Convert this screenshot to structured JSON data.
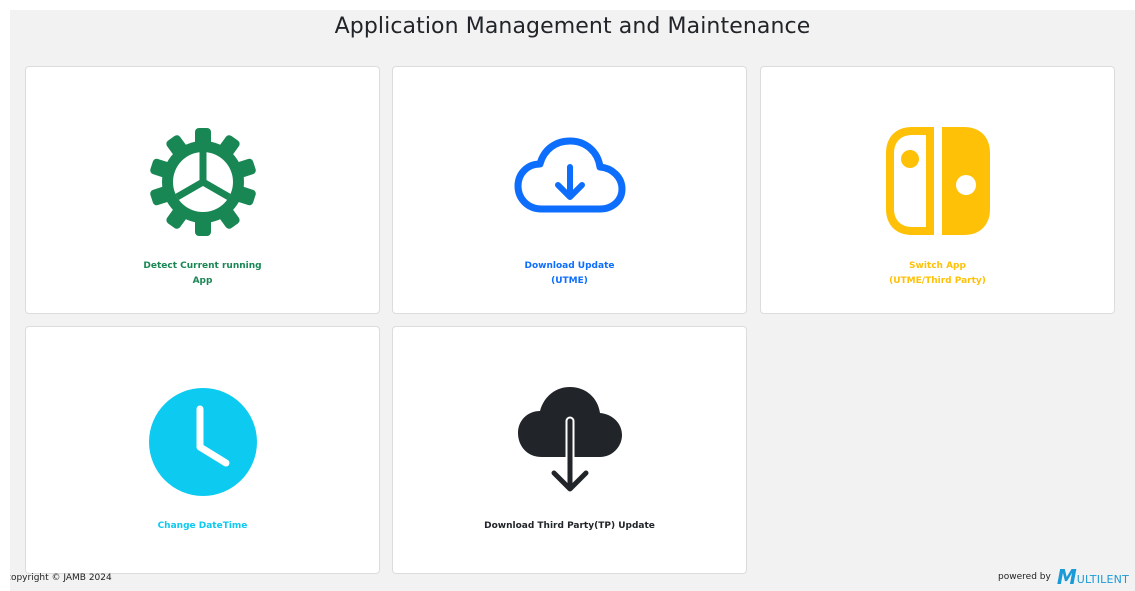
{
  "header": {
    "title": "Application Management and Maintenance"
  },
  "cards": [
    {
      "icon": "gear-icon",
      "color": "#198754",
      "label_lines": [
        "Detect Current running",
        "App"
      ]
    },
    {
      "icon": "cloud-download-icon",
      "color": "#0d6efd",
      "label_lines": [
        "Download Update",
        "(UTME)"
      ]
    },
    {
      "icon": "switch-icon",
      "color": "#ffc107",
      "label_lines": [
        "Switch App",
        "(UTME/Third Party)"
      ]
    },
    {
      "icon": "clock-icon",
      "color": "#0dcaf0",
      "label_lines": [
        "Change DateTime"
      ]
    },
    {
      "icon": "cloud-download-solid-icon",
      "color": "#212529",
      "label_lines": [
        "Download Third Party(TP) Update"
      ]
    }
  ],
  "footer": {
    "copyright": "copyright © JAMB 2024",
    "powered_by": "powered by",
    "brand_mark": "M",
    "brand_text": "ULTILENT"
  }
}
